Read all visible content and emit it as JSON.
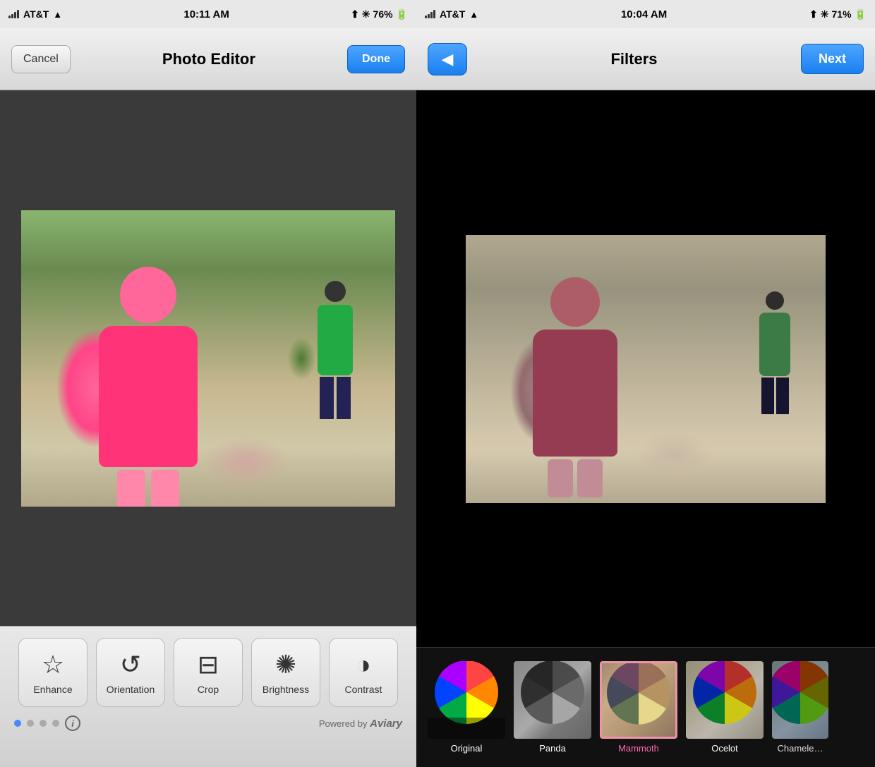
{
  "left": {
    "status": {
      "carrier": "AT&T",
      "time": "10:11 AM",
      "battery": "76%"
    },
    "nav": {
      "cancel_label": "Cancel",
      "title": "Photo Editor",
      "done_label": "Done"
    },
    "tools": [
      {
        "id": "enhance",
        "label": "Enhance",
        "icon": "⭐"
      },
      {
        "id": "orientation",
        "label": "Orientation",
        "icon": "↺"
      },
      {
        "id": "crop",
        "label": "Crop",
        "icon": "⊘"
      },
      {
        "id": "brightness",
        "label": "Brightness",
        "icon": "✳"
      },
      {
        "id": "contrast",
        "label": "Contrast",
        "icon": "◑"
      }
    ],
    "powered_by": "Powered by",
    "brand": "Aviary"
  },
  "right": {
    "status": {
      "carrier": "AT&T",
      "time": "10:04 AM",
      "battery": "71%"
    },
    "nav": {
      "back_label": "←",
      "title": "Filters",
      "next_label": "Next"
    },
    "filters": [
      {
        "id": "original",
        "label": "Original",
        "active": false
      },
      {
        "id": "panda",
        "label": "Panda",
        "active": false
      },
      {
        "id": "mammoth",
        "label": "Mammoth",
        "active": true
      },
      {
        "id": "ocelot",
        "label": "Ocelot",
        "active": false
      },
      {
        "id": "chameleon",
        "label": "Chamele…",
        "active": false
      }
    ]
  }
}
